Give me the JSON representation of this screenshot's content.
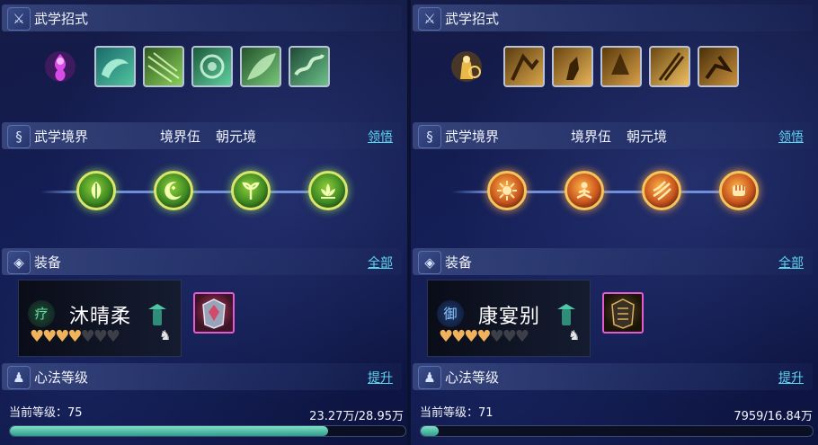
{
  "panels": [
    {
      "skills_title": "武学招式",
      "realm_title": "武学境界",
      "realm_level": "境界伍",
      "realm_name": "朝元境",
      "realm_link": "领悟",
      "equip_title": "装备",
      "equip_link": "全部",
      "character_name": "沐晴柔",
      "character_badge": "疗",
      "hearts_filled": 3.5,
      "hearts_total": 7,
      "xinfa_title": "心法等级",
      "xinfa_link": "提升",
      "current_level_label": "当前等级：75",
      "xp": "23.27万/28.95万",
      "xp_progress": 0.804,
      "theme": "green",
      "skill_icons": [
        "cloud-icon",
        "wind-icon",
        "vortex-icon",
        "leaf-slash-icon",
        "dragon-icon"
      ],
      "realm_nodes": [
        "leaf-icon",
        "moon-icon",
        "sprout-icon",
        "lotus-icon"
      ]
    },
    {
      "skills_title": "武学招式",
      "realm_title": "武学境界",
      "realm_level": "境界伍",
      "realm_name": "朝元境",
      "realm_link": "领悟",
      "equip_title": "装备",
      "equip_link": "全部",
      "character_name": "康宴别",
      "character_badge": "御",
      "hearts_filled": 3.5,
      "hearts_total": 7,
      "xinfa_title": "心法等级",
      "xinfa_link": "提升",
      "current_level_label": "当前等级：71",
      "xp": "7959/16.84万",
      "xp_progress": 0.047,
      "theme": "gold",
      "skill_icons": [
        "warrior-icon",
        "strike-icon",
        "spin-icon",
        "spear-icon",
        "kick-icon"
      ],
      "realm_nodes": [
        "burst-icon",
        "meditate-icon",
        "slash-icon",
        "fist-icon"
      ]
    }
  ],
  "colors": {
    "link": "#5fd4f0",
    "heart_on": "#f0b25a",
    "progress": "#3fb8a0"
  }
}
